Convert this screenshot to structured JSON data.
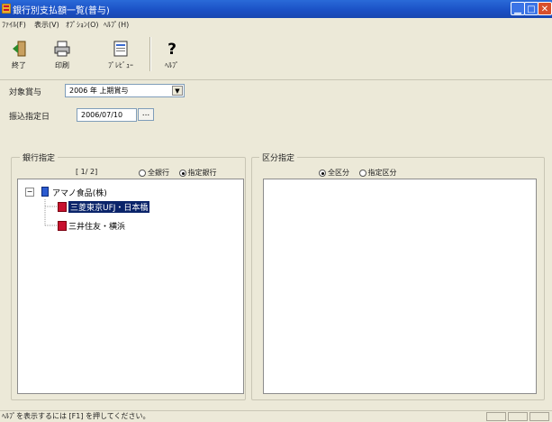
{
  "window": {
    "title": "銀行別支払額一覧(普与)",
    "accent": "#1a4fc4"
  },
  "menu": [
    "ﾌｧｲﾙ(F)",
    "表示(V)",
    "ｵﾌﾟｼｮﾝ(O)",
    "ﾍﾙﾌﾟ(H)"
  ],
  "toolbar": {
    "exit": "終了",
    "print": "印刷",
    "preview": "ﾌﾟﾚﾋﾞｭｰ",
    "help": "ﾍﾙﾌﾟ",
    "help_glyph": "?"
  },
  "form": {
    "target_label": "対象賞与",
    "target_value": "2006 年 上期賞与",
    "date_label": "振込指定日",
    "date_value": "2006/07/10",
    "date_button": "..."
  },
  "bank_group": {
    "title": "銀行指定",
    "counter": "[  1/  2]",
    "radio_all": "全銀行",
    "radio_selected": "指定銀行",
    "selected_mode": "selected",
    "tree": {
      "root": "アマノ食品(株)",
      "children": [
        {
          "label": "三菱東京UFJ・日本橋",
          "selected": true
        },
        {
          "label": "三井住友・横浜",
          "selected": false
        }
      ]
    }
  },
  "category_group": {
    "title": "区分指定",
    "radio_all": "全区分",
    "radio_selected": "指定区分",
    "selected_mode": "all"
  },
  "status": {
    "message": "ﾍﾙﾌﾟを表示するには [F1] を押してください。"
  },
  "icons": [
    "app-icon",
    "exit-icon",
    "print-icon",
    "preview-icon",
    "help-icon",
    "tree-collapse-icon",
    "company-icon",
    "bank-icon"
  ]
}
